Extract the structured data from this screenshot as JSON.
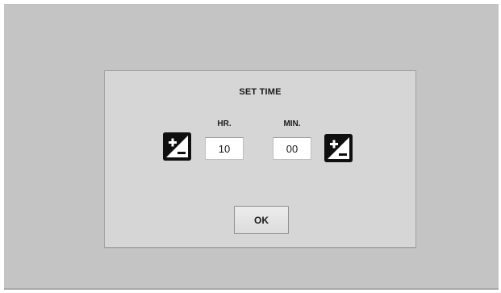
{
  "dialog": {
    "title": "SET TIME",
    "hour": {
      "label": "HR.",
      "value": "10"
    },
    "minute": {
      "label": "MIN.",
      "value": "00"
    },
    "ok_label": "OK"
  },
  "icons": {
    "hour_stepper": "plus-minus-icon",
    "minute_stepper": "plus-minus-icon"
  },
  "colors": {
    "backdrop": "#c4c4c4",
    "dialog": "#d6d6d6",
    "icon_fill": "#0f0f0f"
  }
}
